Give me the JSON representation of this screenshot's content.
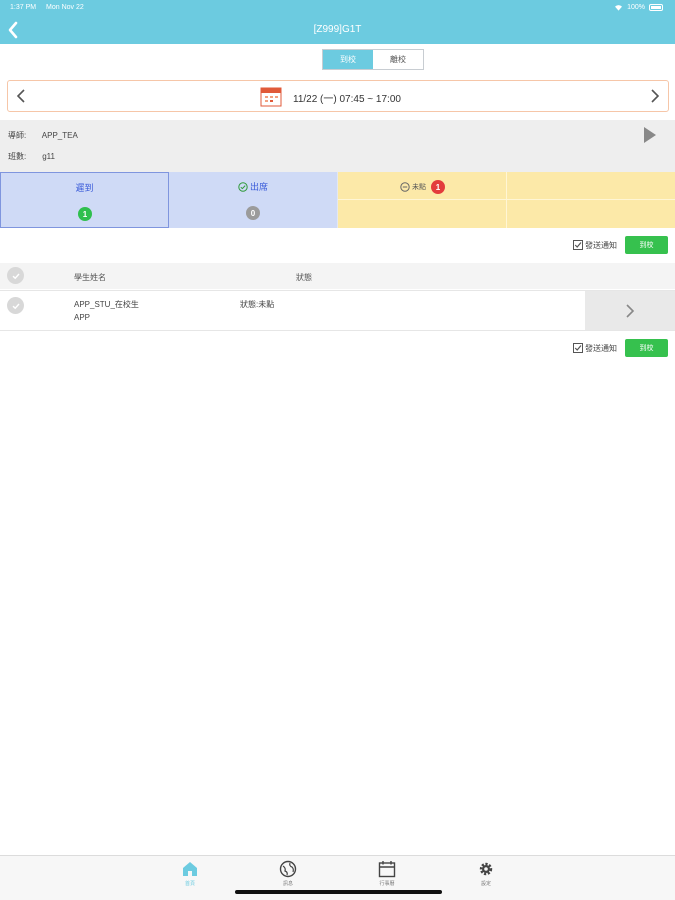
{
  "status_bar": {
    "time": "1:37 PM",
    "date": "Mon Nov 22",
    "battery": "100%"
  },
  "header": {
    "title": "[Z999]G1T"
  },
  "segment": {
    "options": [
      "到校",
      "離校"
    ],
    "selected": "到校"
  },
  "date_bar": {
    "text": "11/22 (一) 07:45 ~ 17:00"
  },
  "info": {
    "teacher_label": "導師:",
    "teacher_value": "APP_TEA",
    "class_label": "班數:",
    "class_value": "g11"
  },
  "counters": [
    {
      "label": "遲到",
      "count": "1"
    },
    {
      "label": "出席",
      "count": "0"
    },
    {
      "label": "未點",
      "count": "1"
    }
  ],
  "actions": {
    "notify_label": "發送通知",
    "button_label": "到校"
  },
  "list": {
    "headers": {
      "name": "學生姓名",
      "status": "狀態"
    },
    "rows": [
      {
        "name_line1": "APP_STU_在校生",
        "name_line2": "APP",
        "status": "狀態:未點"
      }
    ]
  },
  "tabbar": {
    "items": [
      {
        "label": "首頁",
        "icon": "home-icon"
      },
      {
        "label": "訊息",
        "icon": "globe-icon"
      },
      {
        "label": "行事曆",
        "icon": "calendar-icon"
      },
      {
        "label": "設定",
        "icon": "gear-icon"
      }
    ],
    "active": "首頁"
  },
  "colors": {
    "header": "#6ccbe0",
    "late": "#cfdaf6",
    "absent": "#fce9a8",
    "button": "#36c14e",
    "badge_red": "#e33c3c"
  }
}
